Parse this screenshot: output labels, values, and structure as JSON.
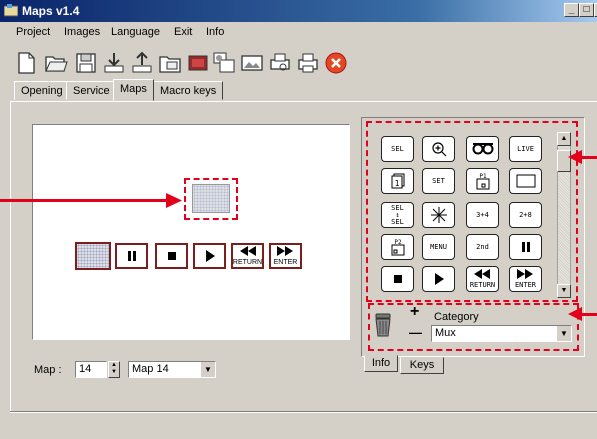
{
  "window": {
    "title": "Maps v1.4"
  },
  "menu": [
    {
      "label": "Project"
    },
    {
      "label": "Images"
    },
    {
      "label": "Language"
    },
    {
      "label": "Exit"
    },
    {
      "label": "Info"
    }
  ],
  "tabs": [
    "Opening",
    "Service",
    "Maps",
    "Macro keys"
  ],
  "active_tab": "Maps",
  "preview_buttons": [
    "II",
    "■",
    "▶",
    "◀◀ RETURN",
    "▶▶ ENTER"
  ],
  "keys": [
    [
      "SEL",
      "zoom",
      "oo",
      "LIVE"
    ],
    [
      "1",
      "SET",
      "P1",
      "box"
    ],
    [
      "SEL SEL",
      "snow",
      "3+4",
      "2+8"
    ],
    [
      "P2",
      "MENU",
      "2nd",
      "II"
    ],
    [
      "■",
      "▶",
      "◀◀ RETURN",
      "▶▶ ENTER"
    ]
  ],
  "category": {
    "label": "Category",
    "value": "Mux",
    "plus": "+",
    "minus": "—"
  },
  "bottom_tabs": [
    "Info",
    "Keys"
  ],
  "map": {
    "label": "Map :",
    "number": "14",
    "name": "Map 14"
  },
  "colors": {
    "annotation": "#e3001b"
  },
  "icons": [
    "new-icon",
    "open-icon",
    "save-icon",
    "import-icon",
    "export-icon",
    "folder-image-icon",
    "map-frame-icon",
    "layers-icon",
    "picture-icon",
    "print-preview-icon",
    "print-icon",
    "close-red-icon"
  ]
}
